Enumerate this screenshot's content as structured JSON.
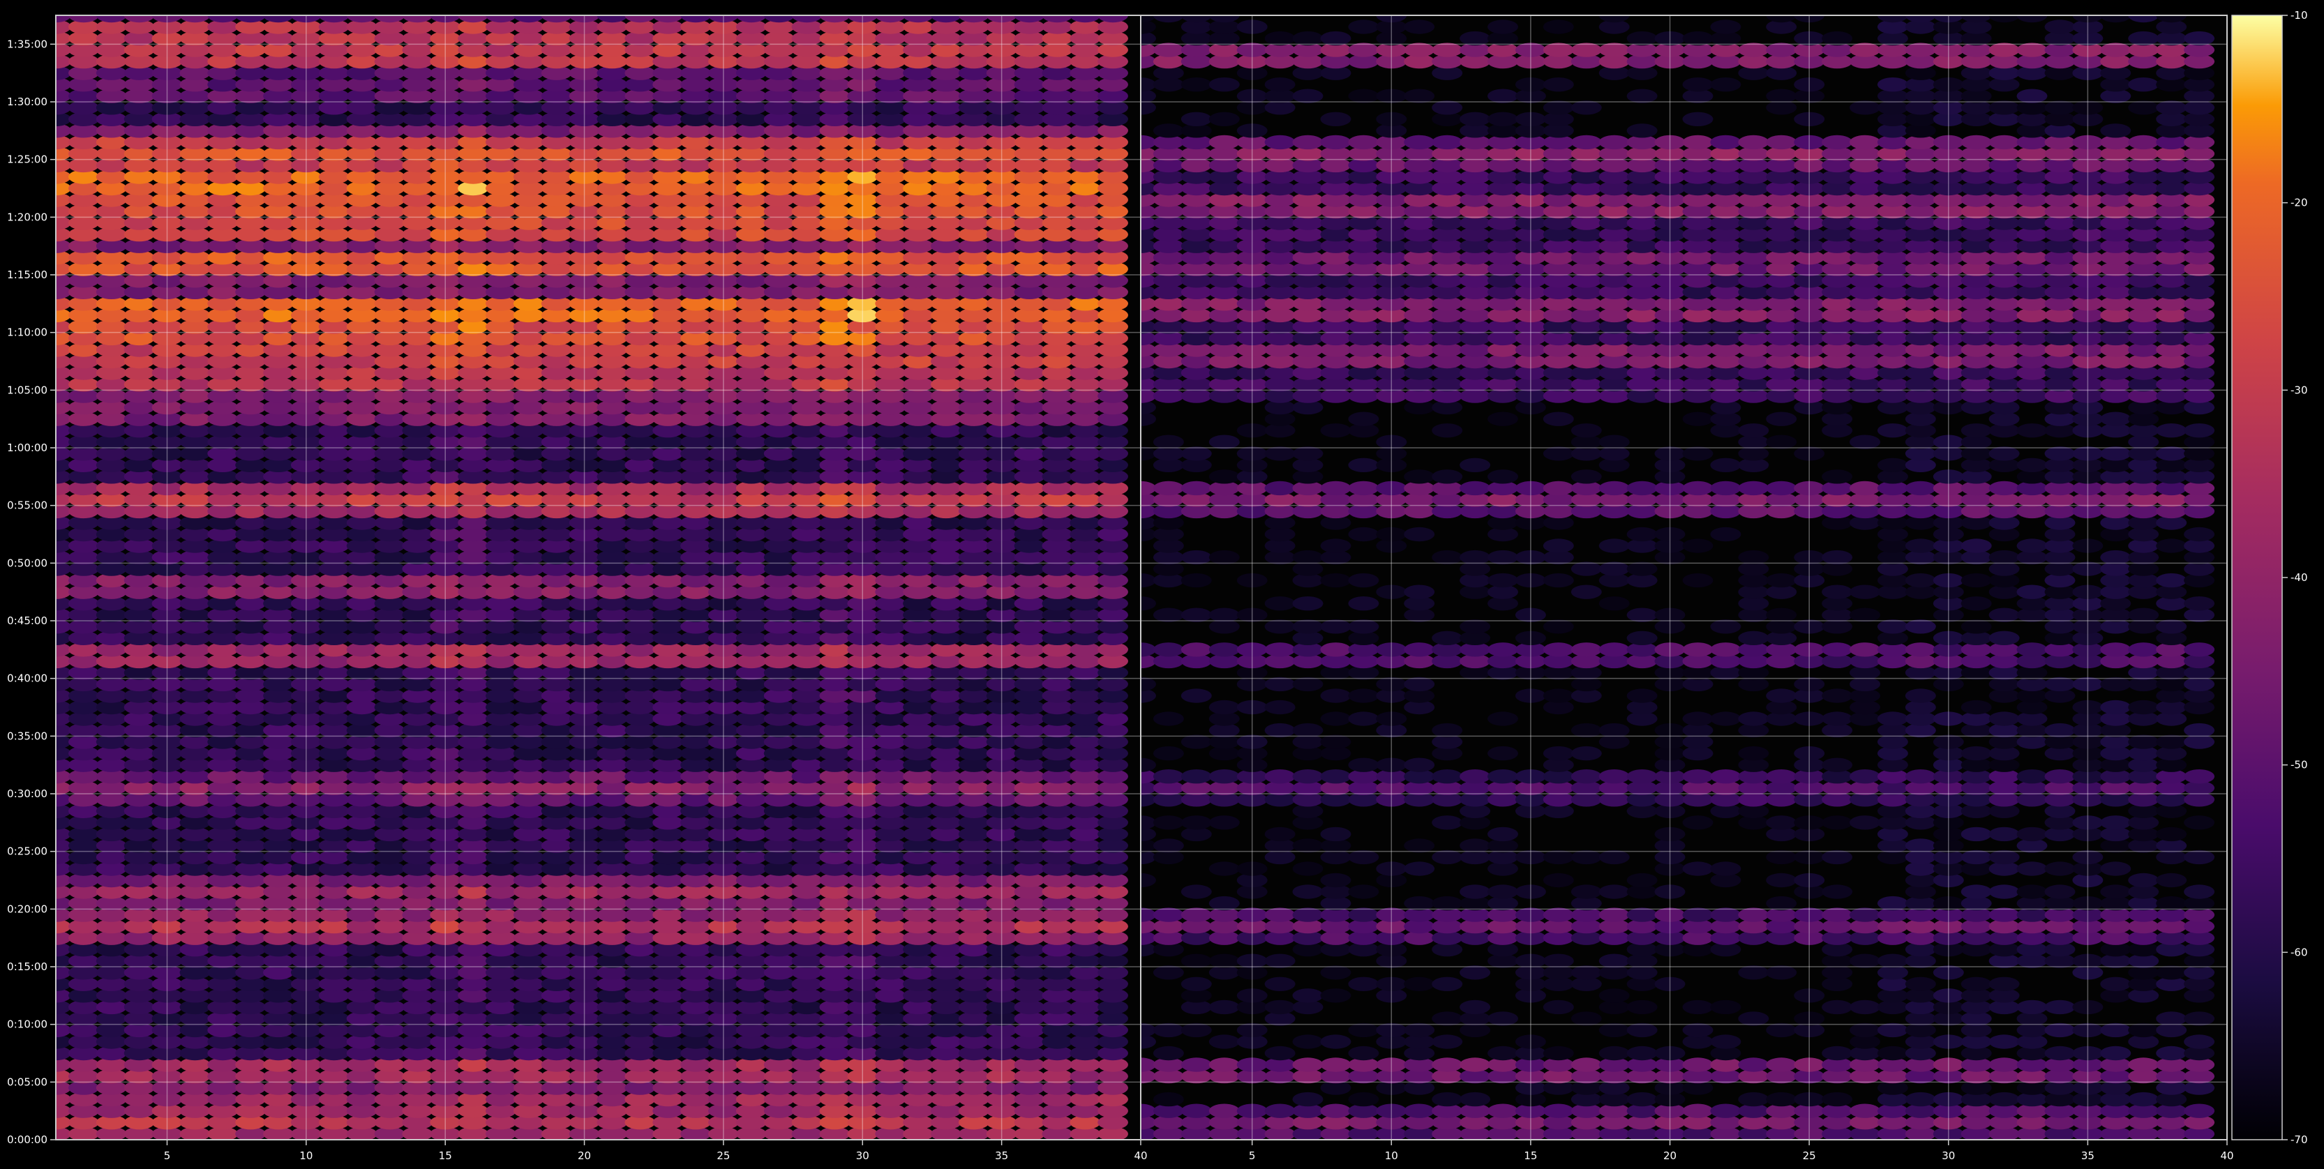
{
  "chart_data": {
    "type": "heatmap",
    "title": "",
    "xlabel": "",
    "ylabel": "",
    "panels": [
      {
        "name": "",
        "xlim": [
          1,
          40
        ]
      },
      {
        "name": "",
        "xlim": [
          1,
          40
        ]
      }
    ],
    "x_ticks": [
      "5",
      "10",
      "15",
      "20",
      "25",
      "30",
      "35",
      "40"
    ],
    "x_tick_values": [
      5,
      10,
      15,
      20,
      25,
      30,
      35,
      40
    ],
    "y_ticks": [
      "0:00:00",
      "0:05:00",
      "0:10:00",
      "0:15:00",
      "0:20:00",
      "0:25:00",
      "0:30:00",
      "0:35:00",
      "0:40:00",
      "0:45:00",
      "0:50:00",
      "0:55:00",
      "1:00:00",
      "1:05:00",
      "1:10:00",
      "1:15:00",
      "1:20:00",
      "1:25:00",
      "1:30:00",
      "1:35:00"
    ],
    "y_tick_minutes": [
      0,
      5,
      10,
      15,
      20,
      25,
      30,
      35,
      40,
      45,
      50,
      55,
      60,
      65,
      70,
      75,
      80,
      85,
      90,
      95
    ],
    "ylim_minutes": [
      0,
      97.5
    ],
    "grid": true,
    "colormap": "inferno",
    "colorbar": {
      "min": -70,
      "max": -10,
      "ticks": [
        "-10",
        "-20",
        "-30",
        "-40",
        "-50",
        "-60",
        "-70"
      ],
      "tick_values": [
        -10,
        -20,
        -30,
        -40,
        -50,
        -60,
        -70
      ]
    },
    "approx_data": {
      "channels": 39,
      "minutes_step": 1,
      "left_panel_loud_bands": [
        {
          "minute": 1.5,
          "level_db": -32
        },
        {
          "minute": 3.5,
          "level_db": -38
        },
        {
          "minute": 6,
          "level_db": -34
        },
        {
          "minute": 18.5,
          "level_db": -34
        },
        {
          "minute": 21.5,
          "level_db": -38
        },
        {
          "minute": 30.5,
          "level_db": -42
        },
        {
          "minute": 42,
          "level_db": -36
        },
        {
          "minute": 48,
          "level_db": -40
        },
        {
          "minute": 55.5,
          "level_db": -30
        },
        {
          "minute": 66,
          "level_db": -30
        },
        {
          "minute": 68,
          "level_db": -26
        },
        {
          "minute": 70,
          "level_db": -22
        },
        {
          "minute": 72,
          "level_db": -18
        },
        {
          "minute": 76,
          "level_db": -20
        },
        {
          "minute": 79,
          "level_db": -24
        },
        {
          "minute": 81,
          "level_db": -22
        },
        {
          "minute": 83,
          "level_db": -18
        },
        {
          "minute": 85.5,
          "level_db": -24
        },
        {
          "minute": 94,
          "level_db": -28
        },
        {
          "minute": 96,
          "level_db": -30
        }
      ],
      "right_panel_loud_bands": [
        {
          "minute": 1.5,
          "level_db": -46
        },
        {
          "minute": 6,
          "level_db": -44
        },
        {
          "minute": 18.5,
          "level_db": -48
        },
        {
          "minute": 30.5,
          "level_db": -52
        },
        {
          "minute": 42,
          "level_db": -50
        },
        {
          "minute": 55.5,
          "level_db": -44
        },
        {
          "minute": 68,
          "level_db": -42
        },
        {
          "minute": 72,
          "level_db": -40
        },
        {
          "minute": 76,
          "level_db": -44
        },
        {
          "minute": 81,
          "level_db": -40
        },
        {
          "minute": 85.5,
          "level_db": -42
        },
        {
          "minute": 94,
          "level_db": -40
        }
      ],
      "right_panel_active_channels": [
        28,
        29,
        30,
        31,
        32,
        33,
        34,
        35,
        36,
        37,
        38,
        39
      ],
      "background_db": -66
    }
  }
}
